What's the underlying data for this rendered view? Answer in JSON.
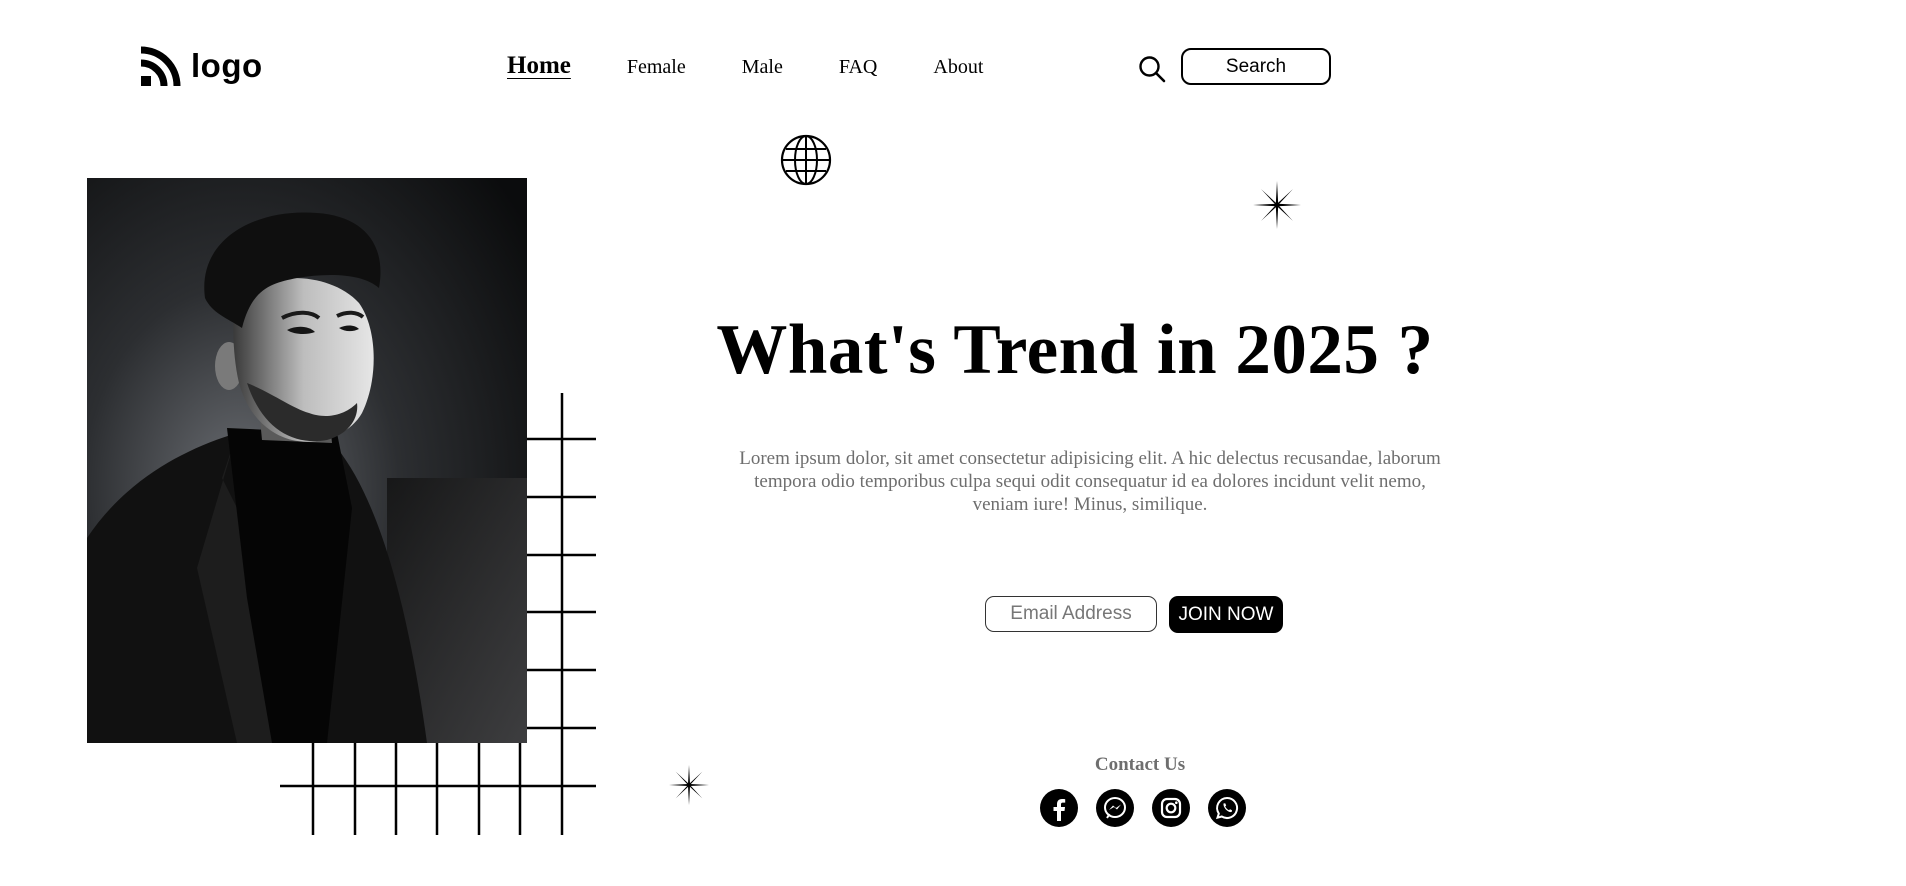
{
  "brand": {
    "logo_text": "logo",
    "logo_icon": "rss-icon"
  },
  "nav": {
    "items": [
      {
        "label": "Home",
        "active": true
      },
      {
        "label": "Female",
        "active": false
      },
      {
        "label": "Male",
        "active": false
      },
      {
        "label": "FAQ",
        "active": false
      },
      {
        "label": "About",
        "active": false
      }
    ]
  },
  "search": {
    "icon": "search-icon",
    "button_label": "Search"
  },
  "hero": {
    "title": "What's Trend in 2025 ?",
    "description": "Lorem ipsum dolor, sit amet consectetur adipisicing elit. A hic delectus recusandae, laborum tempora odio temporibus culpa sequi odit consequatur id ea dolores incidunt velit nemo, veniam iure! Minus, similique."
  },
  "signup": {
    "email_placeholder": "Email Address",
    "email_value": "",
    "join_label": "JOIN NOW"
  },
  "contact": {
    "title": "Contact Us",
    "icons": [
      "facebook-icon",
      "messenger-icon",
      "instagram-icon",
      "whatsapp-icon"
    ]
  },
  "decorations": [
    "globe-icon",
    "sparkle-star-icon",
    "sparkle-star-icon"
  ],
  "colors": {
    "text": "#000000",
    "muted_text": "#6e6e6e",
    "background": "#ffffff",
    "button_bg": "#000000",
    "button_text": "#ffffff"
  }
}
